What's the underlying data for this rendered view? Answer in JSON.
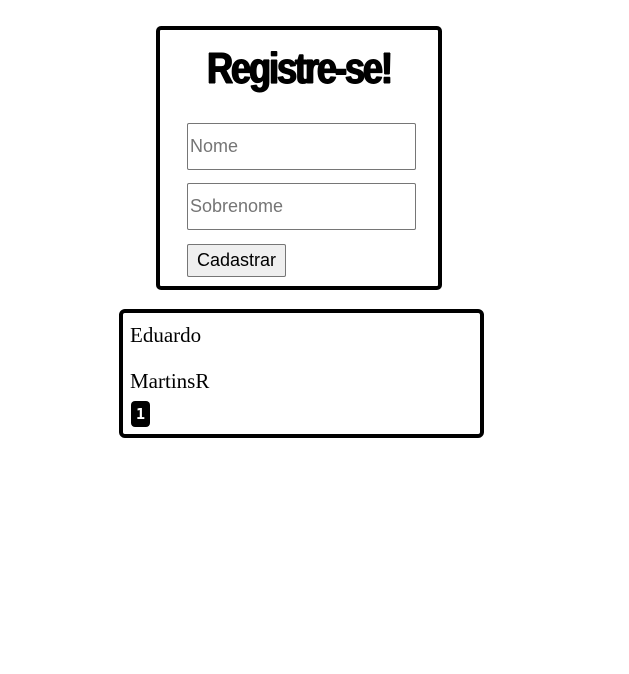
{
  "register": {
    "title": "Registre-se!",
    "first_name_placeholder": "Nome",
    "first_name_value": "",
    "last_name_placeholder": "Sobrenome",
    "last_name_value": "",
    "submit_label": "Cadastrar"
  },
  "result": {
    "first_name": "Eduardo",
    "last_name": "MartinsR",
    "count": "1"
  },
  "colors": {
    "border": "#000000",
    "background": "#ffffff",
    "badge": "#000000",
    "button_bg": "#efefef"
  }
}
